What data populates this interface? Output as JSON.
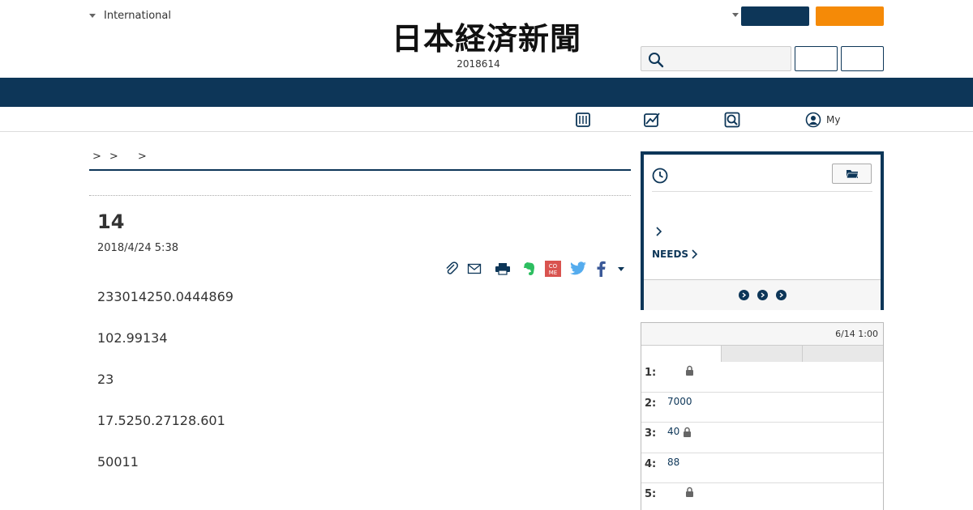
{
  "header": {
    "edition_label": "International",
    "logo_text": "日本経済新聞",
    "date": "2018614"
  },
  "subnav": {
    "my_label": "My"
  },
  "article": {
    "breadcrumb": [
      ">",
      ">",
      ">"
    ],
    "title": "14",
    "date": "2018/4/24 5:38",
    "paragraphs": [
      "233014250.0444869",
      "102.99134",
      "23",
      "17.5250.27128.601",
      "50011"
    ]
  },
  "sidebar": {
    "needs_label": "NEEDS"
  },
  "ranking": {
    "time": "6/14 1:00",
    "rows": [
      {
        "num": "1:",
        "text": "",
        "locked": true
      },
      {
        "num": "2:",
        "text": "7000",
        "locked": false
      },
      {
        "num": "3:",
        "text": "40",
        "locked": true
      },
      {
        "num": "4:",
        "text": "88",
        "locked": false
      },
      {
        "num": "5:",
        "text": "",
        "locked": true
      }
    ]
  },
  "colors": {
    "navy": "#0d3658",
    "orange": "#f58a07"
  }
}
